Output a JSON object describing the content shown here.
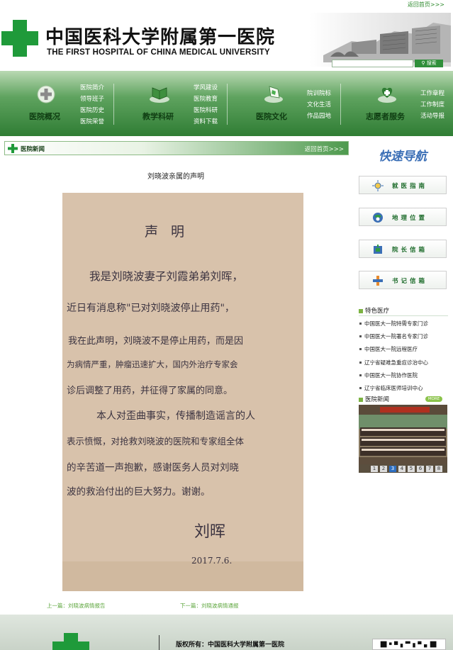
{
  "top": {
    "home_link": "返回首页>>>"
  },
  "header": {
    "logo_cn": "中国医科大学附属第一医院",
    "logo_en": "THE FIRST HOSPITAL OF CHINA MEDICAL UNIVERSITY",
    "search_placeholder": "",
    "search_button": "搜索"
  },
  "nav": [
    {
      "title": "医院概况",
      "icon": "plus-circle-icon",
      "links": [
        "医院简介",
        "领导班子",
        "医院历史",
        "医院荣誉"
      ]
    },
    {
      "title": "教学科研",
      "icon": "book-icon",
      "links": [
        "学风建设",
        "医院教育",
        "医院科研",
        "资料下载"
      ]
    },
    {
      "title": "医院文化",
      "icon": "flag-icon",
      "links": [
        "院训院标",
        "文化生活",
        "作品园地"
      ]
    },
    {
      "title": "志愿者服务",
      "icon": "heart-hands-icon",
      "links": [
        "工作章程",
        "工作制度",
        "活动导报"
      ]
    }
  ],
  "section": {
    "title": "医院新闻",
    "home_link": "返回首页>>>"
  },
  "article": {
    "title": "刘晓波亲属的声明",
    "letter_lines": [
      "声  明",
      "我是刘晓波妻子刘霞弟弟刘晖，",
      "近日有消息称\"已对刘晓波停止用药\"，",
      "我在此声明，刘晓波不是停止用药，而是因",
      "为病情严重，肿瘤迅速扩大，国内外治疗专家会",
      "诊后调整了用药，并征得了家属的同意。",
      "本人对歪曲事实，传播制造谣言的人",
      "表示愤慨，对抢救刘晓波的医院和专家组全体",
      "的辛苦道一声抱歉，感谢医务人员对刘晓",
      "波的救治付出的巨大努力。谢谢。",
      "刘晖",
      "2017.7.6."
    ],
    "prev_label": "上一篇：刘晓波病情报告",
    "next_label": "下一篇：刘晓波病情通报"
  },
  "sidebar": {
    "quick_nav_title": "快速导航",
    "quick_buttons": [
      {
        "label": "就医指南",
        "icon": "sun-icon"
      },
      {
        "label": "地理位置",
        "icon": "globe-icon"
      },
      {
        "label": "院长信箱",
        "icon": "mailbox-icon"
      },
      {
        "label": "书记信箱",
        "icon": "cross-icon"
      }
    ],
    "special_title": "特色医疗",
    "special_items": [
      "中国医大一院特需专家门诊",
      "中国医大一院著名专家门诊",
      "中国医大一院远程医疗",
      "辽宁省疑难急重症诊治中心",
      "中国医大一院协作医院",
      "辽宁省临床医师培训中心"
    ],
    "news_title": "医院新闻",
    "more_badge": "MORE",
    "pager": [
      "1",
      "2",
      "3",
      "4",
      "5",
      "6",
      "7",
      "8"
    ],
    "pager_active": "3"
  },
  "footer": {
    "copyright": "版权所有：中国医科大学附属第一医院"
  },
  "colors": {
    "brand_green": "#1f9a3a",
    "nav_dark": "#2f7d34",
    "link_green": "#5da63d",
    "quick_blue": "#3b6fb6"
  }
}
